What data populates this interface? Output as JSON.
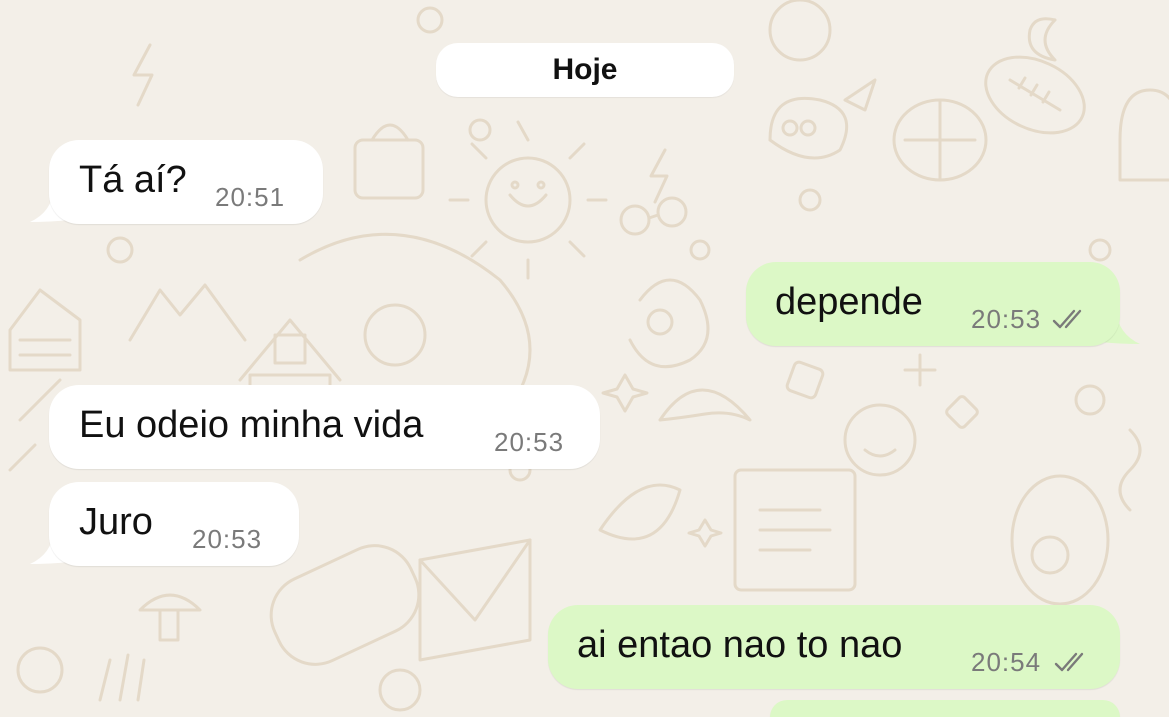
{
  "chat": {
    "date_separator": "Hoje",
    "messages": [
      {
        "direction": "incoming",
        "text": "Tá aí?",
        "time": "20:51"
      },
      {
        "direction": "outgoing",
        "text": "depende",
        "time": "20:53",
        "status": "double-check-icon"
      },
      {
        "direction": "incoming",
        "text": "Eu odeio minha vida",
        "time": "20:53"
      },
      {
        "direction": "incoming",
        "text": "Juro",
        "time": "20:53"
      },
      {
        "direction": "outgoing",
        "text": "ai entao nao to nao",
        "time": "20:54",
        "status": "double-check-icon"
      }
    ]
  },
  "colors": {
    "background": "#f3efe8",
    "incoming_bubble": "#ffffff",
    "outgoing_bubble": "#dcf8c6",
    "tick_color": "#7a7a7a"
  }
}
